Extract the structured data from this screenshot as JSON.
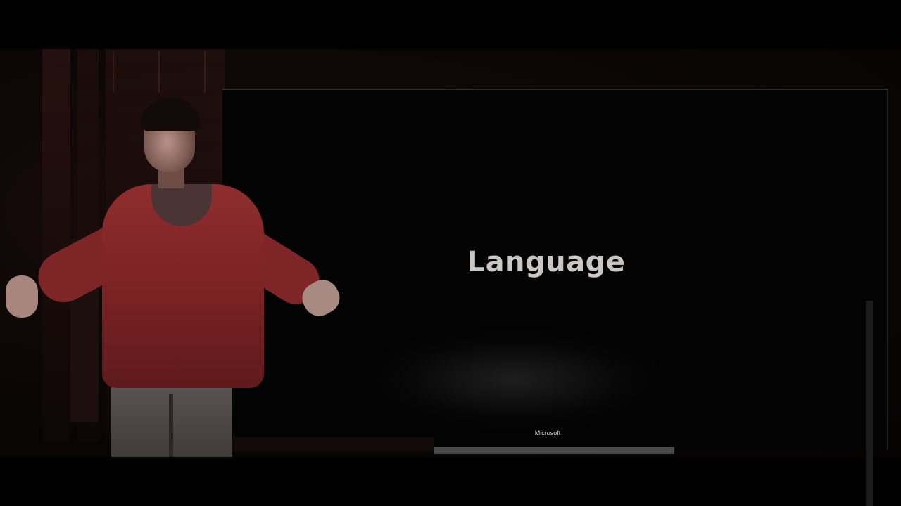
{
  "slide": {
    "title": "Language",
    "brand": "Microsoft"
  },
  "colors": {
    "background": "#000000",
    "slide_text": "#c9c6c4",
    "sweater": "#8e2d2e"
  },
  "scene": {
    "description_tags": [
      "speaker",
      "projection-screen",
      "wood-panelling"
    ]
  }
}
